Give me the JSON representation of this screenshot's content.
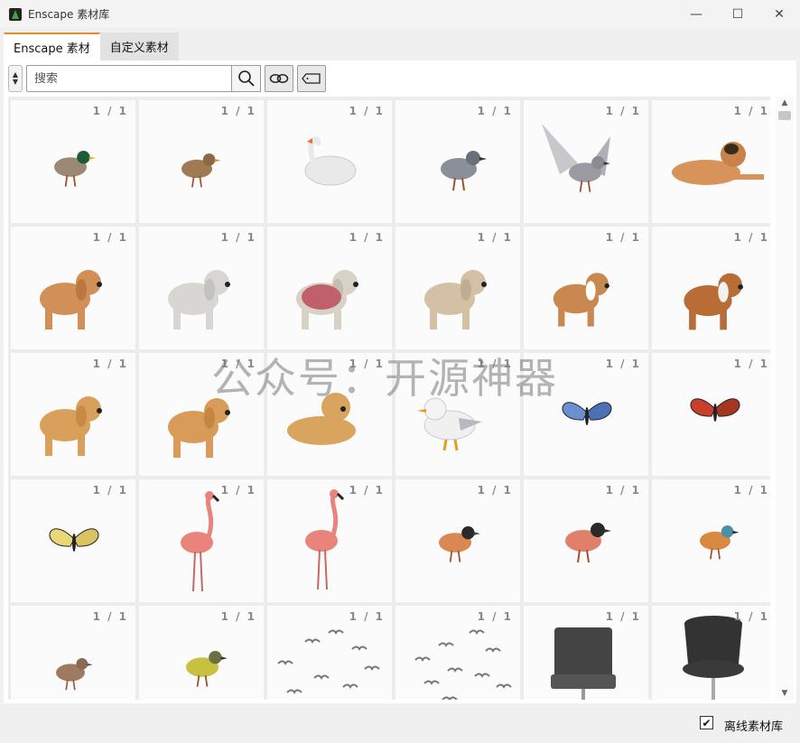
{
  "window": {
    "title": "Enscape 素材库",
    "minimize_glyph": "—",
    "maximize_glyph": "☐",
    "close_glyph": "✕"
  },
  "tabs": [
    {
      "label": "Enscape 素材",
      "active": true
    },
    {
      "label": "自定义素材",
      "active": false
    }
  ],
  "search": {
    "placeholder": "搜索",
    "value": ""
  },
  "toolbar_icons": [
    "sort-arrows-icon",
    "search-icon",
    "link-icon",
    "tag-icon"
  ],
  "accent_color": "#e8892c",
  "assets": [
    {
      "name": "mallard-duck",
      "count": "1 / 1"
    },
    {
      "name": "female-duck",
      "count": "1 / 1"
    },
    {
      "name": "swan",
      "count": "1 / 1"
    },
    {
      "name": "pigeon",
      "count": "1 / 1"
    },
    {
      "name": "flying-pigeon",
      "count": "1 / 1"
    },
    {
      "name": "lying-dog",
      "count": "1 / 1"
    },
    {
      "name": "cocker-spaniel",
      "count": "1 / 1"
    },
    {
      "name": "white-poodle",
      "count": "1 / 1"
    },
    {
      "name": "poodle-pink-coat",
      "count": "1 / 1"
    },
    {
      "name": "beige-poodle",
      "count": "1 / 1"
    },
    {
      "name": "beagle-standing",
      "count": "1 / 1"
    },
    {
      "name": "beagle-lying",
      "count": "1 / 1"
    },
    {
      "name": "golden-retriever",
      "count": "1 / 1"
    },
    {
      "name": "golden-retriever-sitting",
      "count": "1 / 1"
    },
    {
      "name": "golden-retriever-lying",
      "count": "1 / 1"
    },
    {
      "name": "seagull",
      "count": "1 / 1"
    },
    {
      "name": "blue-butterfly",
      "count": "1 / 1"
    },
    {
      "name": "red-butterfly",
      "count": "1 / 1"
    },
    {
      "name": "swallowtail-butterfly",
      "count": "1 / 1"
    },
    {
      "name": "flamingo",
      "count": "1 / 1"
    },
    {
      "name": "flamingo-standing",
      "count": "1 / 1"
    },
    {
      "name": "finch",
      "count": "1 / 1"
    },
    {
      "name": "bullfinch",
      "count": "1 / 1"
    },
    {
      "name": "kingfisher",
      "count": "1 / 1"
    },
    {
      "name": "wren",
      "count": "1 / 1"
    },
    {
      "name": "yellow-wagtail",
      "count": "1 / 1"
    },
    {
      "name": "flock-of-gulls",
      "count": "1 / 1"
    },
    {
      "name": "flock-of-birds",
      "count": "1 / 1"
    },
    {
      "name": "office-chair",
      "count": "1 / 1"
    },
    {
      "name": "dark-chair",
      "count": "1 / 1"
    }
  ],
  "watermark": "公众号：开源神器",
  "footer": {
    "offline_label": "离线素材库",
    "offline_checked": true,
    "check_glyph": "✔"
  }
}
